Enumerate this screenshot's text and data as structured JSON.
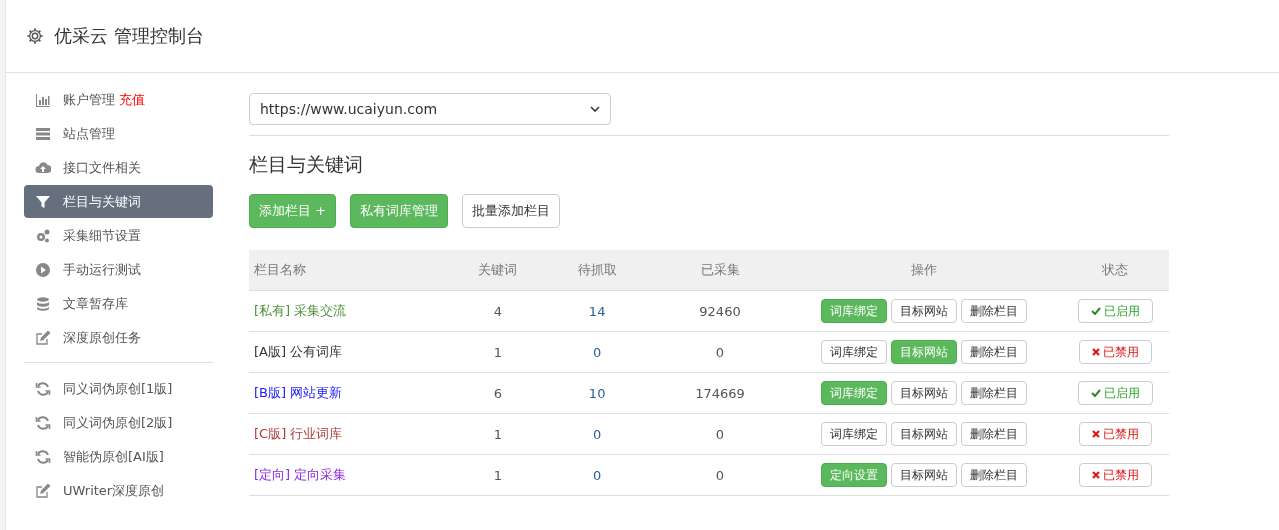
{
  "header": {
    "title": "优采云 管理控制台"
  },
  "sidebar": {
    "items": [
      {
        "kind": "bar-chart",
        "label": "账户管理",
        "badge": "充值",
        "selected": false
      },
      {
        "kind": "server",
        "label": "站点管理",
        "selected": false
      },
      {
        "kind": "cloud-upload",
        "label": "接口文件相关",
        "selected": false
      },
      {
        "kind": "filter",
        "label": "栏目与关键词",
        "selected": true
      },
      {
        "kind": "gears",
        "label": "采集细节设置",
        "selected": false
      },
      {
        "kind": "play",
        "label": "手动运行测试",
        "selected": false
      },
      {
        "kind": "database",
        "label": "文章暂存库",
        "selected": false
      },
      {
        "kind": "edit",
        "label": "深度原创任务",
        "selected": false
      }
    ],
    "items2": [
      {
        "kind": "refresh",
        "label": "同义词伪原创[1版]",
        "selected": false
      },
      {
        "kind": "refresh",
        "label": "同义词伪原创[2版]",
        "selected": false
      },
      {
        "kind": "refresh",
        "label": "智能伪原创[AI版]",
        "selected": false
      },
      {
        "kind": "edit",
        "label": "UWriter深度原创",
        "selected": false
      }
    ]
  },
  "site_select": {
    "value": "https://www.ucaiyun.com"
  },
  "section_title": "栏目与关键词",
  "toolbar": [
    {
      "label": "添加栏目 +",
      "kind": "primary"
    },
    {
      "label": "私有词库管理",
      "kind": "primary"
    },
    {
      "label": "批量添加栏目",
      "kind": "default"
    }
  ],
  "table": {
    "columns": [
      "栏目名称",
      "关键词",
      "待抓取",
      "已采集",
      "操作",
      "状态"
    ],
    "rows": [
      {
        "tag": "[私有]",
        "name": "采集交流",
        "color": "#4e8f3a",
        "keywords": "4",
        "pending": "14",
        "collected": "92460",
        "actions": [
          {
            "label": "词库绑定",
            "on": true
          },
          {
            "label": "目标网站",
            "on": false
          },
          {
            "label": "删除栏目",
            "on": false
          }
        ],
        "status": "已启用",
        "enabled": true
      },
      {
        "tag": "[A版]",
        "name": "公有词库",
        "color": "#333333",
        "keywords": "1",
        "pending": "0",
        "collected": "0",
        "actions": [
          {
            "label": "词库绑定",
            "on": false
          },
          {
            "label": "目标网站",
            "on": true
          },
          {
            "label": "删除栏目",
            "on": false
          }
        ],
        "status": "已禁用",
        "enabled": false
      },
      {
        "tag": "[B版]",
        "name": "网站更新",
        "color": "#1a1aff",
        "keywords": "6",
        "pending": "10",
        "collected": "174669",
        "actions": [
          {
            "label": "词库绑定",
            "on": true
          },
          {
            "label": "目标网站",
            "on": false
          },
          {
            "label": "删除栏目",
            "on": false
          }
        ],
        "status": "已启用",
        "enabled": true
      },
      {
        "tag": "[C版]",
        "name": "行业词库",
        "color": "#b03a3a",
        "keywords": "1",
        "pending": "0",
        "collected": "0",
        "actions": [
          {
            "label": "词库绑定",
            "on": false
          },
          {
            "label": "目标网站",
            "on": false
          },
          {
            "label": "删除栏目",
            "on": false
          }
        ],
        "status": "已禁用",
        "enabled": false
      },
      {
        "tag": "[定向]",
        "name": "定向采集",
        "color": "#8a2be2",
        "keywords": "1",
        "pending": "0",
        "collected": "0",
        "actions": [
          {
            "label": "定向设置",
            "on": true
          },
          {
            "label": "目标网站",
            "on": false
          },
          {
            "label": "删除栏目",
            "on": false
          }
        ],
        "status": "已禁用",
        "enabled": false
      }
    ]
  }
}
